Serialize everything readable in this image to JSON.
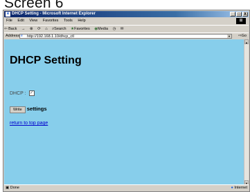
{
  "caption": "Screen 6",
  "window": {
    "title": "DHCP Setting - Microsoft Internet Explorer",
    "controls": [
      "_",
      "□",
      "X"
    ]
  },
  "menu": [
    "File",
    "Edit",
    "View",
    "Favorites",
    "Tools",
    "Help"
  ],
  "toolbar": {
    "back": "Back",
    "forward": "→",
    "search": "Search",
    "favorites": "Favorites",
    "media": "Media"
  },
  "address": {
    "label": "Address",
    "url": "http://192.168.1.10/dhcp_ctl",
    "go": "Go"
  },
  "page": {
    "heading": "DHCP Setting",
    "dhcp_label": "DHCP :",
    "dhcp_checked": true,
    "write_button": "Write",
    "write_text": "settings",
    "return_link": "return to top page"
  },
  "status": {
    "left": "Done",
    "zone": "Internet"
  },
  "colors": {
    "content_bg": "#87ceeb",
    "link": "#0000cc"
  }
}
